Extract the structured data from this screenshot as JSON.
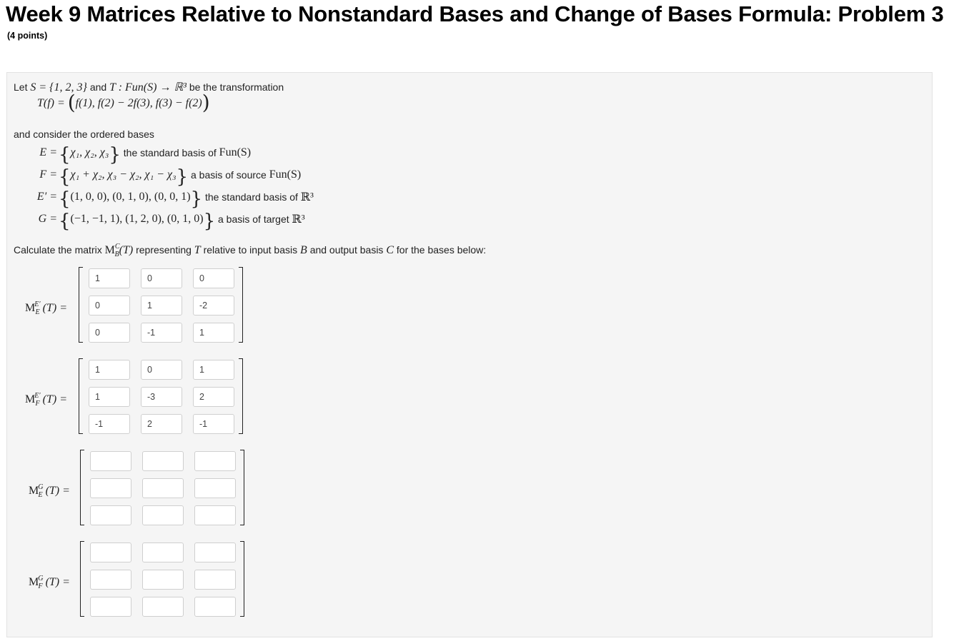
{
  "header": {
    "title": "Week 9 Matrices Relative to Nonstandard Bases and Change of Bases Formula: Problem 3",
    "points": "(4 points)"
  },
  "problem": {
    "intro_let": "Let",
    "intro_S": "S = {1, 2, 3}",
    "intro_and": "and",
    "intro_T": "T : Fun(S) → ℝ³",
    "intro_be": "be the transformation",
    "transform_lhs": "T(f) =",
    "transform_body": "f(1),  f(2) − 2f(3),  f(3) − f(2)",
    "consider": "and consider the ordered bases",
    "bases": [
      {
        "lhs": "E =",
        "set": "χ₁,  χ₂,  χ₃",
        "desc": "the standard basis of",
        "desc_math": "Fun(S)"
      },
      {
        "lhs": "F =",
        "set": "χ₁ + χ₂,  χ₃ − χ₂,  χ₁ − χ₃",
        "desc": "a basis of source",
        "desc_math": "Fun(S)"
      },
      {
        "lhs": "E′ =",
        "set": "(1, 0, 0),  (0, 1, 0),  (0, 0, 1)",
        "desc": "the standard basis of",
        "desc_math": "ℝ³"
      },
      {
        "lhs": "G =",
        "set": "(−1, −1, 1),  (1, 2, 0),  (0, 1, 0)",
        "desc": "a basis of target",
        "desc_math": "ℝ³"
      }
    ],
    "calc_pre": "Calculate the matrix",
    "calc_matrix": "M",
    "calc_sup": "C",
    "calc_sub": "B",
    "calc_arg": "(T)",
    "calc_mid": "representing",
    "calc_T": "T",
    "calc_rel": "relative to input basis",
    "calc_B": "B",
    "calc_out": "and output basis",
    "calc_C": "C",
    "calc_end": "for the bases below:"
  },
  "matrices": [
    {
      "sup": "E′",
      "sub": "E",
      "values": [
        [
          "1",
          "0",
          "0"
        ],
        [
          "0",
          "1",
          "-2"
        ],
        [
          "0",
          "-1",
          "1"
        ]
      ]
    },
    {
      "sup": "E′",
      "sub": "F",
      "values": [
        [
          "1",
          "0",
          "1"
        ],
        [
          "1",
          "-3",
          "2"
        ],
        [
          "-1",
          "2",
          "-1"
        ]
      ]
    },
    {
      "sup": "G",
      "sub": "E",
      "values": [
        [
          "",
          "",
          ""
        ],
        [
          "",
          "",
          ""
        ],
        [
          "",
          "",
          ""
        ]
      ]
    },
    {
      "sup": "G",
      "sub": "F",
      "values": [
        [
          "",
          "",
          ""
        ],
        [
          "",
          "",
          ""
        ],
        [
          "",
          "",
          ""
        ]
      ]
    }
  ],
  "matrix_label_main": "M",
  "matrix_label_arg": "(T) ="
}
